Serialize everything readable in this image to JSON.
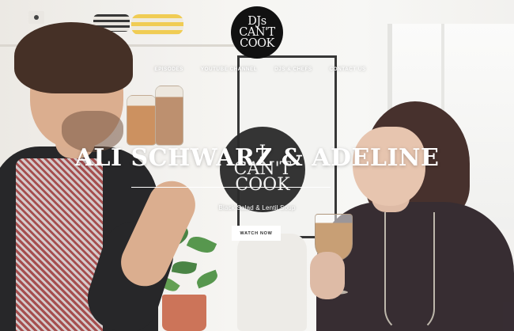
{
  "brand": {
    "logo_line1": "DJs",
    "logo_line2": "CAN'T",
    "logo_line3": "COOK"
  },
  "nav": {
    "items": [
      {
        "label": "EPISODES"
      },
      {
        "label": "YOUTUBE CHANNEL"
      },
      {
        "label": "DJS & CHEFS"
      },
      {
        "label": "CONTACT US"
      }
    ]
  },
  "hero": {
    "title": "ALI SCHWARZ & ADELINE",
    "subtitle": "Black Salad & Lentil Soup",
    "cta_label": "WATCH NOW"
  },
  "colors": {
    "logo_bg": "#111111",
    "text": "#ffffff",
    "button_bg": "#ffffff",
    "button_text": "#2a2a2a"
  }
}
